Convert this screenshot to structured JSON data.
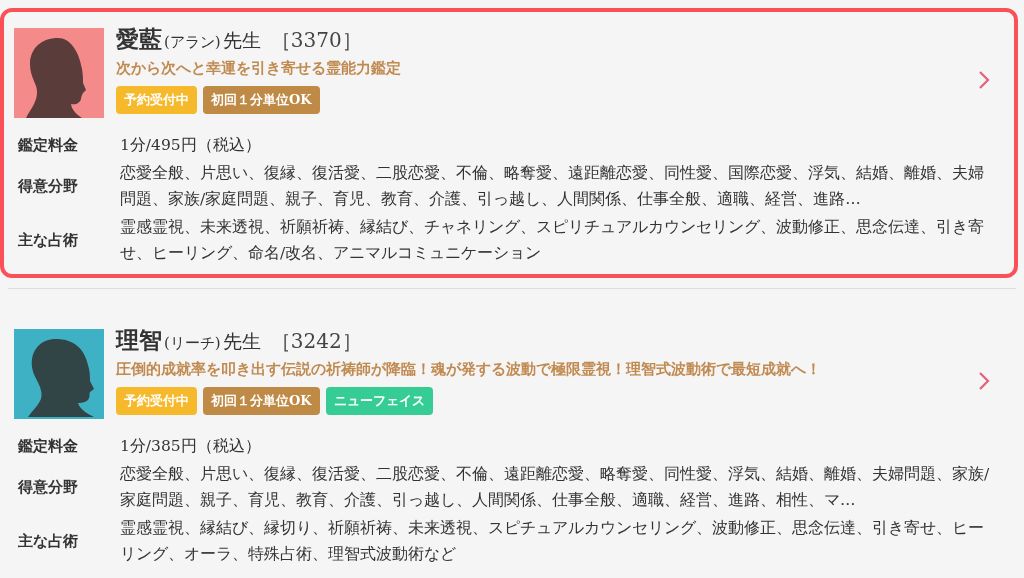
{
  "fortune_tellers": [
    {
      "selected": true,
      "avatar": {
        "color": "#f58a8a",
        "kind": "female"
      },
      "name": "愛藍",
      "reading": "(アラン)",
      "honorific": "先生",
      "code": "［3370］",
      "catchphrase": "次から次へと幸運を引き寄せる霊能力鑑定",
      "tags": [
        {
          "label": "予約受付中",
          "color": "#f6b92b"
        },
        {
          "label": "初回１分単位OK",
          "color": "#bf8a45"
        }
      ],
      "details": [
        {
          "label": "鑑定料金",
          "value": "1分/495円（税込）"
        },
        {
          "label": "得意分野",
          "value": "恋愛全般、片思い、復縁、復活愛、二股恋愛、不倫、略奪愛、遠距離恋愛、同性愛、国際恋愛、浮気、結婚、離婚、夫婦問題、家族/家庭問題、親子、育児、教育、介護、引っ越し、人間関係、仕事全般、適職、経営、進路…"
        },
        {
          "label": "主な占術",
          "value": "霊感霊視、未来透視、祈願祈祷、縁結び、チャネリング、スピリチュアルカウンセリング、波動修正、思念伝達、引き寄せ、ヒーリング、命名/改名、アニマルコミュニケーション"
        }
      ]
    },
    {
      "selected": false,
      "avatar": {
        "color": "#3fb1c4",
        "kind": "male"
      },
      "name": "理智",
      "reading": "(リーチ)",
      "honorific": "先生",
      "code": "［3242］",
      "catchphrase": "圧倒的成就率を叩き出す伝説の祈祷師が降臨！魂が発する波動で極限霊視！理智式波動術で最短成就へ！",
      "tags": [
        {
          "label": "予約受付中",
          "color": "#f6b92b"
        },
        {
          "label": "初回１分単位OK",
          "color": "#bf8a45"
        },
        {
          "label": "ニューフェイス",
          "color": "#35cc96"
        }
      ],
      "details": [
        {
          "label": "鑑定料金",
          "value": "1分/385円（税込）"
        },
        {
          "label": "得意分野",
          "value": "恋愛全般、片思い、復縁、復活愛、二股恋愛、不倫、遠距離恋愛、略奪愛、同性愛、浮気、結婚、離婚、夫婦問題、家族/家庭問題、親子、育児、教育、介護、引っ越し、人間関係、仕事全般、適職、経営、進路、相性、マ…"
        },
        {
          "label": "主な占術",
          "value": "霊感霊視、縁結び、縁切り、祈願祈祷、未来透視、スピチュアルカウンセリング、波動修正、思念伝達、引き寄せ、ヒーリング、オーラ、特殊占術、理智式波動術など"
        }
      ]
    }
  ]
}
